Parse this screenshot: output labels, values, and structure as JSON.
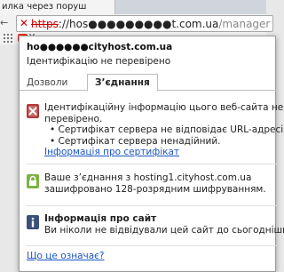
{
  "browser": {
    "tab_title": "илка через поруш",
    "url": {
      "scheme": "https",
      "rest_before_host": "://",
      "host": "hos●●●●●●●●●t.com.ua",
      "path": "/manager"
    },
    "bookmark_label": "Y"
  },
  "popup": {
    "site_host": "ho●●●●●●cityhost.com.ua",
    "site_status": "Ідентифікацію не перевірено",
    "tabs": [
      "Дозволи",
      "З’єднання"
    ],
    "identity": {
      "line1": "Ідентифікаційну інформацію цього веб-сайта не",
      "line2": "перевірено.",
      "bullet1": "• Сертифікат сервера не відповідає URL-адресі.",
      "bullet2": "• Сертифікат сервера ненадійний.",
      "link": "Інформація про сертифікат"
    },
    "encryption": {
      "line1": "Ваше з’єднання з hosting1.cityhost.com.ua",
      "line2": "зашифровано 128-розрядним шифруванням."
    },
    "site_info": {
      "title": "Інформація про сайт",
      "text": "Ви ніколи не відвідували цей сайт до сьогоднішн"
    },
    "help_link": "Що це означає?"
  },
  "colors": {
    "error_red": "#c42b1c",
    "secure_green": "#7cb342",
    "info_blue": "#3a4f7a",
    "link_blue": "#1a55c5"
  }
}
